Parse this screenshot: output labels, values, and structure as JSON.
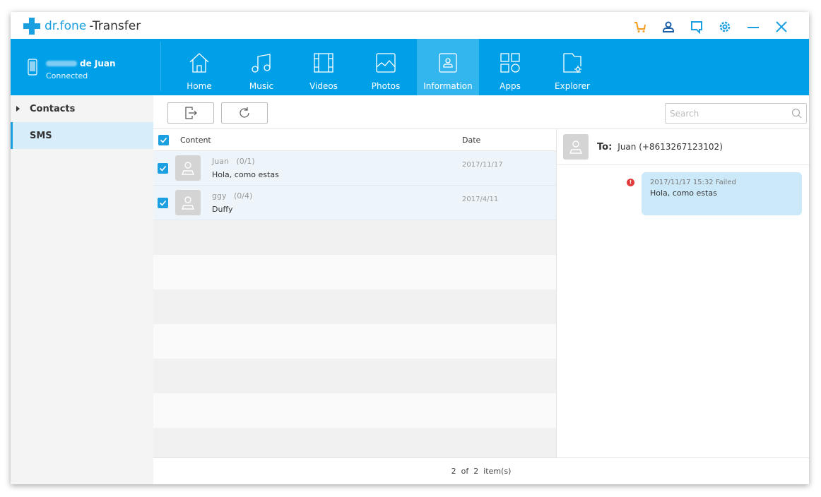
{
  "app": {
    "brand": "dr.fone",
    "product": "-Transfer"
  },
  "titlebar_icons": [
    "cart-icon",
    "user-icon",
    "feedback-icon",
    "settings-icon",
    "minimize-icon",
    "close-icon"
  ],
  "device": {
    "name_suffix": "de Juan",
    "status": "Connected"
  },
  "nav_tabs": [
    {
      "label": "Home",
      "icon": "home-icon"
    },
    {
      "label": "Music",
      "icon": "music-icon"
    },
    {
      "label": "Videos",
      "icon": "videos-icon"
    },
    {
      "label": "Photos",
      "icon": "photos-icon"
    },
    {
      "label": "Information",
      "icon": "information-icon",
      "active": true
    },
    {
      "label": "Apps",
      "icon": "apps-icon"
    },
    {
      "label": "Explorer",
      "icon": "explorer-icon"
    }
  ],
  "sidebar": {
    "items": [
      {
        "label": "Contacts"
      },
      {
        "label": "SMS",
        "active": true
      }
    ]
  },
  "toolbar": {
    "export_icon": "export-icon",
    "refresh_icon": "refresh-icon",
    "search_placeholder": "Search"
  },
  "list": {
    "headers": {
      "content": "Content",
      "date": "Date"
    },
    "rows": [
      {
        "name": "Juan",
        "count": "(0/1)",
        "message": "Hola, como estas",
        "date": "2017/11/17",
        "checked": true
      },
      {
        "name": "ggy",
        "count": "(0/4)",
        "message": "Duffy",
        "date": "2017/4/11",
        "checked": true
      }
    ]
  },
  "detail": {
    "to_label": "To:",
    "to_value": "Juan (+8613267123102)",
    "messages": [
      {
        "meta": "2017/11/17 15:32 Failed",
        "text": "Hola, como estas",
        "status": "failed"
      }
    ]
  },
  "footer": {
    "count_text": "2  of  2  item(s)"
  },
  "colors": {
    "accent": "#00a0e9",
    "active_tab": "#33b5ee",
    "cart": "#f29b1e",
    "error": "#e03a3a",
    "bubble": "#cbe9f9"
  }
}
